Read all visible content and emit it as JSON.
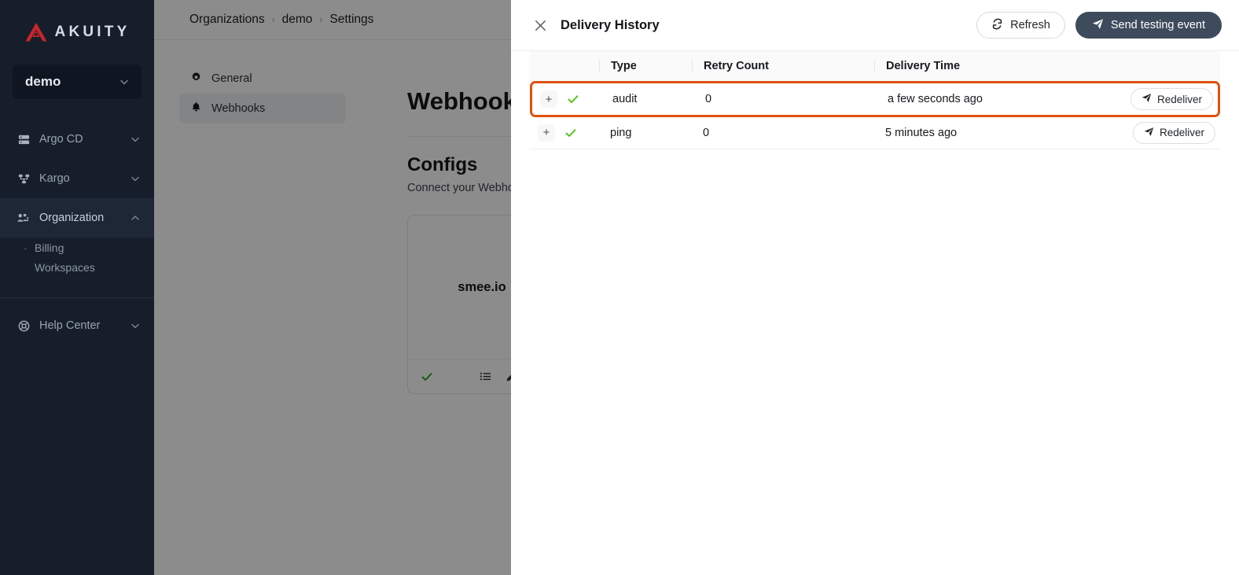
{
  "sidebar": {
    "brand": "AKUITY",
    "org_selector": {
      "value": "demo",
      "icon": "chevron-down-icon"
    },
    "items": [
      {
        "label": "Argo CD",
        "icon": "server-icon",
        "chevron": "chevron-down-icon",
        "active": false
      },
      {
        "label": "Kargo",
        "icon": "kargo-icon",
        "chevron": "chevron-down-icon",
        "active": false
      },
      {
        "label": "Organization",
        "icon": "users-icon",
        "chevron": "chevron-up-icon",
        "active": true
      }
    ],
    "sub_items": [
      {
        "label": "Billing",
        "bullet": "·"
      },
      {
        "label": "Workspaces",
        "bullet": ""
      }
    ],
    "help": {
      "label": "Help Center",
      "icon": "help-icon",
      "chevron": "chevron-down-icon"
    }
  },
  "breadcrumb": {
    "items": [
      "Organizations",
      "demo",
      "Settings"
    ],
    "separator": "›"
  },
  "settings_nav": [
    {
      "label": "General",
      "icon": "gear-icon",
      "active": false
    },
    {
      "label": "Webhooks",
      "icon": "bell-icon",
      "active": true
    }
  ],
  "page": {
    "title": "Webhooks",
    "section_title": "Configs",
    "section_subtitle": "Connect your Webhook service",
    "card": {
      "name": "smee.io",
      "status_icon": "check-icon",
      "actions": [
        "list-icon",
        "pencil-icon",
        "trash-icon"
      ]
    }
  },
  "drawer": {
    "title": "Delivery History",
    "close_icon": "close-icon",
    "refresh_button": {
      "label": "Refresh",
      "icon": "refresh-icon"
    },
    "send_button": {
      "label": "Send testing event",
      "icon": "send-icon"
    },
    "table": {
      "columns": [
        "",
        "",
        "Type",
        "Retry Count",
        "Delivery Time",
        ""
      ],
      "rows": [
        {
          "expand": "+",
          "status": "check-icon",
          "type": "audit",
          "retry_count": "0",
          "delivery_time": "a few seconds ago",
          "action_label": "Redeliver",
          "action_icon": "send-icon",
          "highlighted": true
        },
        {
          "expand": "+",
          "status": "check-icon",
          "type": "ping",
          "retry_count": "0",
          "delivery_time": "5 minutes ago",
          "action_label": "Redeliver",
          "action_icon": "send-icon",
          "highlighted": false
        }
      ]
    }
  },
  "colors": {
    "sidebar_bg": "#161e2b",
    "brand_red": "#c8262a",
    "highlight_border": "#e0520f",
    "primary_button": "#3d4b5c",
    "success_green": "#52c41a",
    "danger_red": "#e03131"
  }
}
